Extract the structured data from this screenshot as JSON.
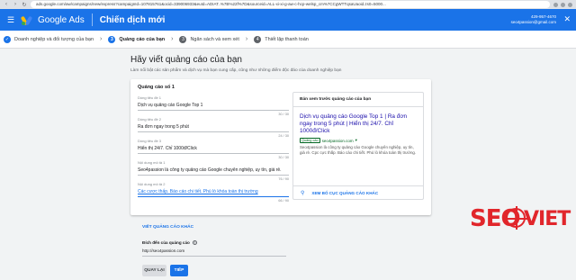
{
  "browser": {
    "url": "ads.google.com/aw/campaigns/new/express?campaignId=107815761&ocid=339006933&euId=ADIAT..%7B%22f%7D&sourceid=ALL-xi-xi-g-aw-c-hcp-welsp_cm%7CCgWTTqsaUaoid.zs0=5000..."
  },
  "header": {
    "app_name": "Google Ads",
    "campaign_title": "Chiến dịch mới",
    "account_id": "429-957-4670",
    "account_email": "seo4passion@gmail.com"
  },
  "stepper": {
    "steps": [
      {
        "label": "Doanh nghiệp và đối tượng của bạn",
        "state": "done",
        "number": ""
      },
      {
        "label": "Quảng cáo của bạn",
        "state": "current",
        "number": "3"
      },
      {
        "label": "Ngân sách và xem xét",
        "state": "todo",
        "number": "3"
      },
      {
        "label": "Thiết lập thanh toán",
        "state": "todo",
        "number": "4"
      }
    ]
  },
  "main": {
    "title": "Hãy viết quảng cáo của bạn",
    "subtitle": "Làm nổi bật các sản phẩm và dịch vụ mà bạn cung cấp, cũng như những điểm độc đáo của doanh nghiệp bạn",
    "ad_card": {
      "title": "Quảng cáo số 1",
      "fields": [
        {
          "label": "Dòng tiêu đề 1",
          "value": "Dịch vụ quảng cáo Google Top 1",
          "count": "30 / 30"
        },
        {
          "label": "Dòng tiêu đề 2",
          "value": "Ra đơn ngay trong 5 phút",
          "count": "24 / 30"
        },
        {
          "label": "Dòng tiêu đề 3",
          "value": "Hiển thị 24/7. Chỉ 1000đ/Click",
          "count": "30 / 30"
        },
        {
          "label": "Nội dung mô tả 1",
          "value": "Seo4passion là công ty quảng cáo Google chuyên nghiệp, uy tín, giá rẻ.",
          "count": "76 / 90"
        },
        {
          "label": "Nội dung mô tả 2",
          "value": "Các cược thấp. Báo cáo chi tiết. Phù lò khóa toàn thị trường",
          "count": "66 / 90"
        }
      ]
    },
    "preview": {
      "heading": "Bản xem trước quảng cáo của bạn",
      "headline": "Dịch vụ quảng cáo Google Top 1 | Ra đơn ngay trong 5 phút | Hiển thị 24/7. Chỉ 1000đ/Click",
      "ad_badge": "Quảng cáo",
      "display_url": "seo4passion.com",
      "description": "Seo4passion là công ty quảng cáo Google chuyên nghiệp, uy tín, giá rẻ. Cpc cực thấp. Báo cáo chi tiết. Phủ lò khóa toàn thị trường.",
      "more_layouts": "XEM BỐ CỤC QUẢNG CÁO KHÁC"
    },
    "more_ads_link": "VIẾT QUẢNG CÁO KHÁC",
    "destination": {
      "label": "Đích đến của quảng cáo",
      "value": "http://seo4passion.com"
    },
    "buttons": {
      "back": "QUAY LẠI",
      "next": "TIẾP"
    }
  },
  "watermark": {
    "brand_left": "SEO",
    "brand_right": "VIET"
  },
  "colors": {
    "brand_blue": "#1a73e8",
    "logo_red": "#e1262b"
  }
}
